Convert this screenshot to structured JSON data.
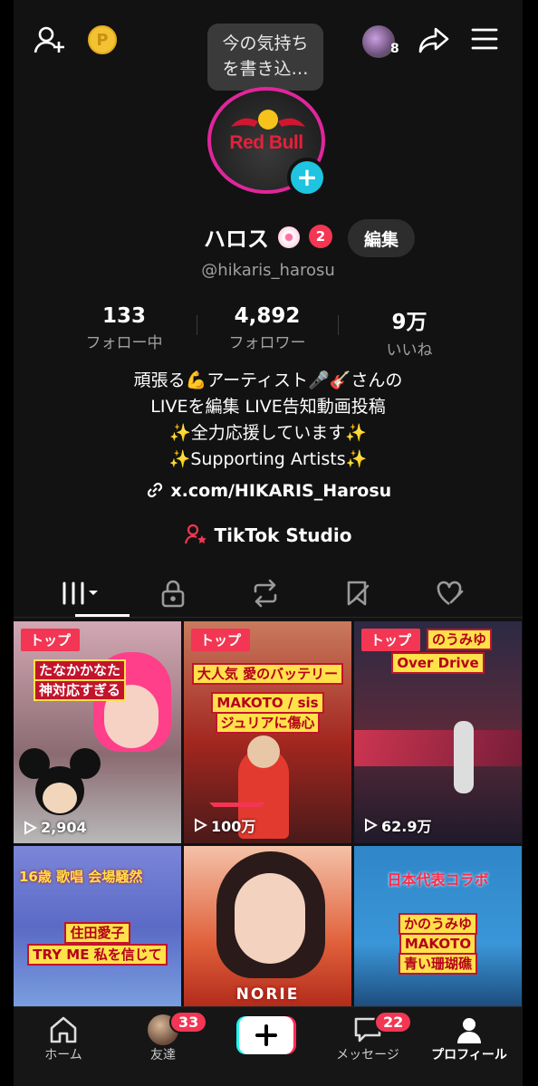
{
  "header": {
    "mood_text": "今の気持ち\nを書き込…",
    "friends_count": "8",
    "coin_symbol": "P"
  },
  "profile": {
    "avatar_text": "Red Bull",
    "avatar_add": "+",
    "name": "ハロス",
    "notification_count": "2",
    "edit_label": "編集",
    "handle": "@hikaris_harosu"
  },
  "stats": [
    {
      "value": "133",
      "label": "フォロー中"
    },
    {
      "value": "4,892",
      "label": "フォロワー"
    },
    {
      "value": "9万",
      "label": "いいね"
    }
  ],
  "bio": [
    "頑張る💪アーティスト🎤🎸さんの",
    "LIVEを編集  LIVE告知動画投稿",
    "✨全力応援しています✨",
    "✨Supporting Artists✨"
  ],
  "link": "x.com/HIKARIS_Harosu",
  "studio": "TikTok Studio",
  "videos": [
    {
      "badge": "トップ",
      "caption1": "たなかかなた",
      "caption2": "神対応すぎる",
      "views": "2,904",
      "bg": "#a07b86"
    },
    {
      "badge": "トップ",
      "caption1": "大人気 愛のバッテリー",
      "caption2": "MAKOTO / sis",
      "caption3": "ジュリアに傷心",
      "views": "100万",
      "bg": "#8a2a2a"
    },
    {
      "badge": "トップ",
      "caption1": "のうみゆ",
      "caption2": "Over Drive",
      "views": "62.9万",
      "bg": "#3a2a4a"
    },
    {
      "caption1": "16歳 歌唱 会場騒然",
      "caption2": "住田愛子",
      "caption3": "TRY ME 私を信じて",
      "bg": "#6a6fc0"
    },
    {
      "caption1": "NORIE",
      "bg": "#c0452a"
    },
    {
      "caption1": "日本代表コラボ",
      "caption2": "かのうみゆ",
      "caption3": "MAKOTO",
      "caption4": "青い珊瑚礁",
      "bg": "#2a6fb0"
    }
  ],
  "nav": {
    "home": "ホーム",
    "friends": "友達",
    "friends_badge": "33",
    "messages": "メッセージ",
    "messages_badge": "22",
    "profile": "プロフィール"
  },
  "colors": {
    "accent": "#f23653",
    "ring": "#e0269b",
    "add": "#1ec4e0"
  }
}
